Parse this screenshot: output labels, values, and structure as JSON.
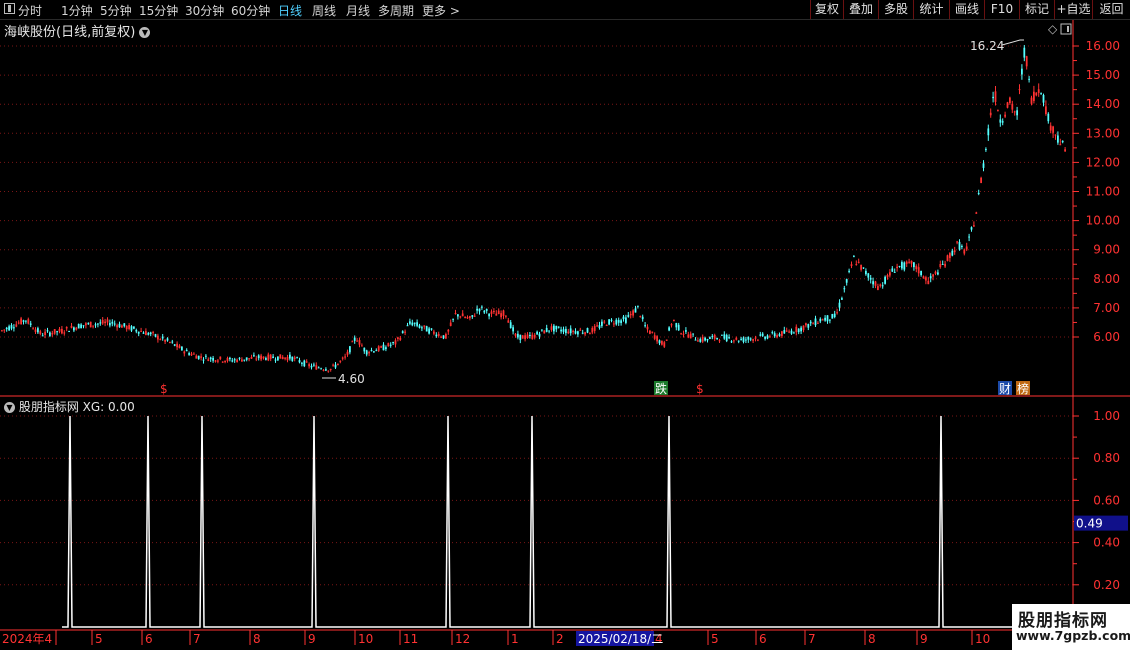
{
  "toolbar": {
    "periods": [
      "分时",
      "1分钟",
      "5分钟",
      "15分钟",
      "30分钟",
      "60分钟",
      "日线",
      "周线",
      "月线",
      "多周期",
      "更多 >"
    ],
    "active_period": "日线",
    "right_buttons": [
      "复权",
      "叠加",
      "多股",
      "统计",
      "画线",
      "F10",
      "标记",
      "+自选",
      "返回"
    ]
  },
  "main_panel": {
    "title": "海峡股份(日线,前复权)",
    "high_label": "16.24",
    "low_label": "4.60",
    "y_ticks": [
      "16.00",
      "15.00",
      "14.00",
      "13.00",
      "12.00",
      "11.00",
      "10.00",
      "9.00",
      "8.00",
      "7.00",
      "6.00"
    ],
    "markers": [
      "$",
      "跌",
      "$",
      "财",
      "榜"
    ],
    "colors": {
      "up": "#ff3232",
      "down": "#54ffff",
      "grid": "#7a1616",
      "axis": "#ff3232"
    }
  },
  "indicator_panel": {
    "title": "股朋指标网 XG: 0.00",
    "y_ticks": [
      "1.00",
      "0.80",
      "0.60",
      "0.40",
      "0.20"
    ],
    "cursor_value": "0.49"
  },
  "x_axis": {
    "labels": [
      "2024年4",
      "5",
      "6",
      "7",
      "8",
      "9",
      "10",
      "11",
      "12",
      "1",
      "2",
      "4",
      "5",
      "6",
      "7",
      "8",
      "9",
      "10"
    ],
    "cursor_date": "2025/02/18/二"
  },
  "watermark": {
    "line1": "股朋指标网",
    "line2": "www.7gpzb.com"
  },
  "chart_data": {
    "type": "candlestick",
    "title": "海峡股份(日线,前复权)",
    "price_ylim": [
      4.6,
      16.24
    ],
    "price_path": [
      [
        0,
        6.2
      ],
      [
        25,
        6.6
      ],
      [
        40,
        6.1
      ],
      [
        60,
        6.2
      ],
      [
        80,
        6.4
      ],
      [
        110,
        6.5
      ],
      [
        130,
        6.3
      ],
      [
        150,
        6.1
      ],
      [
        170,
        5.8
      ],
      [
        185,
        5.5
      ],
      [
        200,
        5.3
      ],
      [
        230,
        5.2
      ],
      [
        260,
        5.3
      ],
      [
        290,
        5.3
      ],
      [
        310,
        5.0
      ],
      [
        330,
        4.9
      ],
      [
        345,
        5.3
      ],
      [
        355,
        6.0
      ],
      [
        365,
        5.5
      ],
      [
        380,
        5.6
      ],
      [
        395,
        5.8
      ],
      [
        410,
        6.5
      ],
      [
        430,
        6.2
      ],
      [
        445,
        6.0
      ],
      [
        455,
        6.8
      ],
      [
        470,
        6.6
      ],
      [
        478,
        7.0
      ],
      [
        490,
        6.8
      ],
      [
        505,
        6.8
      ],
      [
        515,
        6.0
      ],
      [
        530,
        6.0
      ],
      [
        550,
        6.3
      ],
      [
        570,
        6.2
      ],
      [
        590,
        6.2
      ],
      [
        605,
        6.5
      ],
      [
        625,
        6.6
      ],
      [
        637,
        7.0
      ],
      [
        645,
        6.3
      ],
      [
        655,
        6.0
      ],
      [
        663,
        5.7
      ],
      [
        672,
        6.6
      ],
      [
        680,
        6.2
      ],
      [
        700,
        5.9
      ],
      [
        720,
        6.0
      ],
      [
        740,
        5.9
      ],
      [
        760,
        6.0
      ],
      [
        780,
        6.1
      ],
      [
        800,
        6.3
      ],
      [
        820,
        6.6
      ],
      [
        835,
        6.7
      ],
      [
        845,
        7.8
      ],
      [
        853,
        8.7
      ],
      [
        865,
        8.2
      ],
      [
        878,
        7.7
      ],
      [
        895,
        8.4
      ],
      [
        912,
        8.5
      ],
      [
        928,
        7.9
      ],
      [
        945,
        8.6
      ],
      [
        957,
        9.2
      ],
      [
        965,
        8.9
      ],
      [
        975,
        10.2
      ],
      [
        985,
        12.5
      ],
      [
        993,
        14.5
      ],
      [
        1000,
        13.4
      ],
      [
        1008,
        14.1
      ],
      [
        1016,
        13.6
      ],
      [
        1024,
        16.0
      ],
      [
        1030,
        14.2
      ],
      [
        1040,
        14.6
      ],
      [
        1048,
        13.4
      ],
      [
        1058,
        12.8
      ],
      [
        1066,
        12.3
      ]
    ],
    "xg_signal_positions": [
      70,
      148,
      202,
      314,
      448,
      532,
      669,
      941
    ],
    "xg_ylim": [
      0,
      1
    ]
  }
}
